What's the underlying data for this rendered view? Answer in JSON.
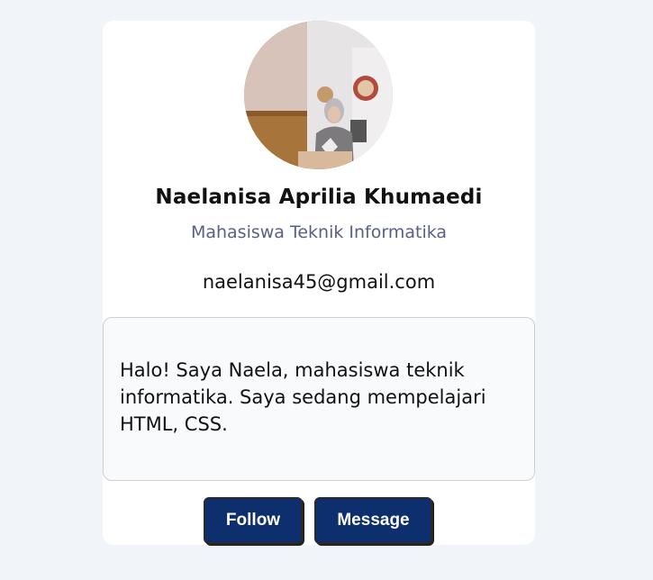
{
  "profile": {
    "name": "Naelanisa Aprilia Khumaedi",
    "role": "Mahasiswa Teknik Informatika",
    "email": "naelanisa45@gmail.com",
    "bio": "Halo! Saya Naela, mahasiswa teknik informatika. Saya sedang mempelajari HTML, CSS."
  },
  "actions": {
    "follow_label": "Follow",
    "message_label": "Message"
  },
  "colors": {
    "page_background": "#f1f4f8",
    "button": "#0d2f6e",
    "role_text": "#5a5f86"
  }
}
